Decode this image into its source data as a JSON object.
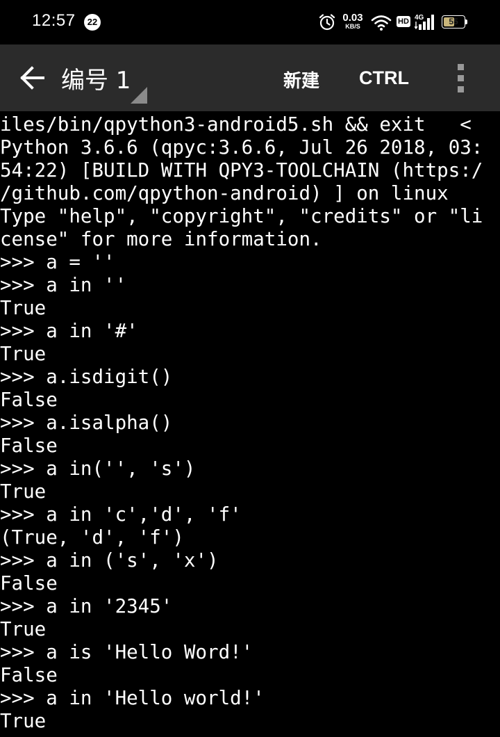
{
  "status_bar": {
    "time": "12:57",
    "notification_count": "22",
    "net_speed_value": "0.03",
    "net_speed_unit": "KB/S",
    "hd_label": "HD",
    "network_type": "4G",
    "battery_level": "55",
    "battery_fraction": 0.55
  },
  "toolbar": {
    "title": "编号 1",
    "new_label": "新建",
    "ctrl_label": "CTRL"
  },
  "terminal": {
    "lines": [
      "iles/bin/qpython3-android5.sh && exit   <",
      "Python 3.6.6 (qpyc:3.6.6, Jul 26 2018, 03:",
      "54:22) [BUILD WITH QPY3-TOOLCHAIN (https:/",
      "/github.com/qpython-android) ] on linux",
      "Type \"help\", \"copyright\", \"credits\" or \"li",
      "cense\" for more information.",
      ">>> a = ''",
      ">>> a in ''",
      "True",
      ">>> a in '#'",
      "True",
      ">>> a.isdigit()",
      "False",
      ">>> a.isalpha()",
      "False",
      ">>> a in('', 's')",
      "True",
      ">>> a in 'c','d', 'f'",
      "(True, 'd', 'f')",
      ">>> a in ('s', 'x')",
      "False",
      ">>> a in '2345'",
      "True",
      ">>> a is 'Hello Word!'",
      "False",
      ">>> a in 'Hello world!'",
      "True"
    ]
  }
}
